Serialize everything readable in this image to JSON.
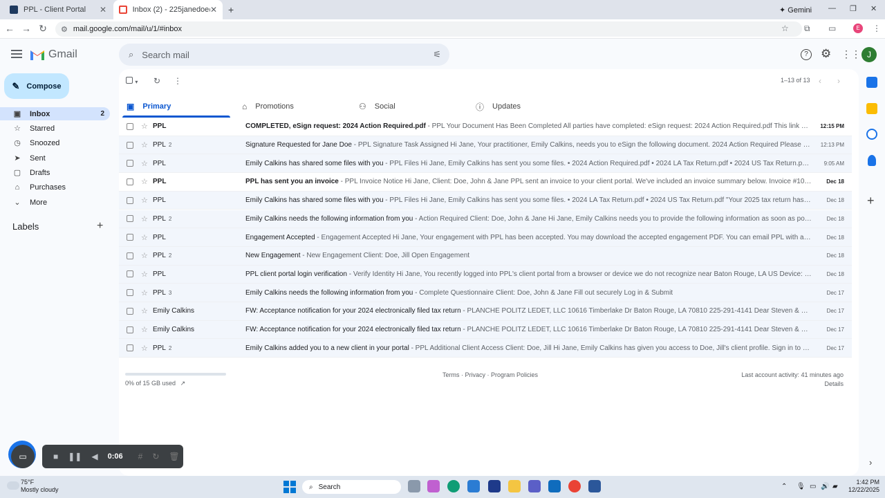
{
  "browser": {
    "tabs": [
      {
        "title": "PPL - Client Portal",
        "active": false
      },
      {
        "title": "Inbox (2) - 225janedoe@gmail...",
        "active": true
      }
    ],
    "new_tab": "+",
    "gemini": "Gemini",
    "url": "mail.google.com/mail/u/1/#inbox",
    "profile_initial": "E"
  },
  "gmail": {
    "logo_text": "Gmail",
    "search_placeholder": "Search mail",
    "avatar_initial": "J",
    "compose_label": "Compose",
    "nav": [
      {
        "label": "Inbox",
        "count": "2",
        "icon": "inbox-icon",
        "selected": true
      },
      {
        "label": "Starred",
        "count": "",
        "icon": "star-icon",
        "selected": false
      },
      {
        "label": "Snoozed",
        "count": "",
        "icon": "clock-icon",
        "selected": false
      },
      {
        "label": "Sent",
        "count": "",
        "icon": "send-icon",
        "selected": false
      },
      {
        "label": "Drafts",
        "count": "",
        "icon": "draft-icon",
        "selected": false
      },
      {
        "label": "Purchases",
        "count": "",
        "icon": "tag-icon",
        "selected": false
      },
      {
        "label": "More",
        "count": "",
        "icon": "chevron-down-icon",
        "selected": false
      }
    ],
    "labels_title": "Labels",
    "pager": "1–13 of 13",
    "category_tabs": [
      {
        "label": "Primary",
        "icon": "inbox-icon",
        "active": true
      },
      {
        "label": "Promotions",
        "icon": "tag-icon",
        "active": false
      },
      {
        "label": "Social",
        "icon": "people-icon",
        "active": false
      },
      {
        "label": "Updates",
        "icon": "info-icon",
        "active": false
      }
    ],
    "emails": [
      {
        "sender": "PPL",
        "count": "",
        "subject": "COMPLETED, eSign request: 2024 Action Required.pdf",
        "snippet": " - PPL Your Document Has Been Completed All parties have completed: eSign request: 2024 Action Required.pdf This link will expir...",
        "date": "12:15 PM",
        "unread": true
      },
      {
        "sender": "PPL",
        "count": "2",
        "subject": "Signature Requested for Jane Doe",
        "snippet": " - PPL Signature Task Assigned Hi Jane, Your practitioner, Emily Calkins, needs you to eSign the following document. 2024 Action Required Please click the...",
        "date": "12:13 PM",
        "unread": false
      },
      {
        "sender": "PPL",
        "count": "",
        "subject": "Emily Calkins has shared some files with you",
        "snippet": " - PPL Files Hi Jane, Emily Calkins has sent you some files. • 2024 Action Required.pdf • 2024 LA Tax Return.pdf • 2024 US Tax Return.pdf \"Your 2...",
        "date": "9:05 AM",
        "unread": false
      },
      {
        "sender": "PPL",
        "count": "",
        "subject": "PPL has sent you an invoice",
        "snippet": " - PPL Invoice Notice Hi Jane, Client: Doe, John & Jane PPL sent an invoice to your client portal. We've included an invoice summary below. Invoice #1067 Invoic...",
        "date": "Dec 18",
        "unread": true
      },
      {
        "sender": "PPL",
        "count": "",
        "subject": "Emily Calkins has shared some files with you",
        "snippet": " - PPL Files Hi Jane, Emily Calkins has sent you some files. • 2024 LA Tax Return.pdf • 2024 US Tax Return.pdf \"Your 2025 tax return has been po...",
        "date": "Dec 18",
        "unread": false
      },
      {
        "sender": "PPL",
        "count": "2",
        "subject": "Emily Calkins needs the following information from you",
        "snippet": " - Action Required Client: Doe, John & Jane Hi Jane, Emily Calkins needs you to provide the following information as soon as possible. ...",
        "date": "Dec 18",
        "unread": false
      },
      {
        "sender": "PPL",
        "count": "",
        "subject": "Engagement Accepted",
        "snippet": " - Engagement Accepted Hi Jane, Your engagement with PPL has been accepted. You may download the accepted engagement PDF. You can email PPL with any ques...",
        "date": "Dec 18",
        "unread": false
      },
      {
        "sender": "PPL",
        "count": "2",
        "subject": "New Engagement",
        "snippet": " - New Engagement Client: Doe, Jill Open Engagement",
        "date": "Dec 18",
        "unread": false
      },
      {
        "sender": "PPL",
        "count": "",
        "subject": "PPL client portal login verification",
        "snippet": " - Verify Identity Hi Jane, You recently logged into PPL's client portal from a browser or device we do not recognize near Baton Rouge, LA US Device: Chrom...",
        "date": "Dec 18",
        "unread": false
      },
      {
        "sender": "PPL",
        "count": "3",
        "subject": "Emily Calkins needs the following information from you",
        "snippet": " - Complete Questionnaire Client: Doe, John & Jane Fill out securely Log in & Submit",
        "date": "Dec 17",
        "unread": false
      },
      {
        "sender": "Emily Calkins",
        "count": "",
        "subject": "FW: Acceptance notification for your 2024 electronically filed tax return",
        "snippet": " - PLANCHE POLITZ LEDET, LLC 10616 Timberlake Dr Baton Rouge, LA 70810 225-291-4141 Dear Steven & Emily: Your ...",
        "date": "Dec 17",
        "unread": false
      },
      {
        "sender": "Emily Calkins",
        "count": "",
        "subject": "FW: Acceptance notification for your 2024 electronically filed tax return",
        "snippet": " - PLANCHE POLITZ LEDET, LLC 10616 Timberlake Dr Baton Rouge, LA 70810 225-291-4141 Dear Steven & Emily: Your ...",
        "date": "Dec 17",
        "unread": false
      },
      {
        "sender": "PPL",
        "count": "2",
        "subject": "Emily Calkins added you to a new client in your portal",
        "snippet": " - PPL Additional Client Access Client: Doe, Jill Hi Jane, Emily Calkins has given you access to Doe, Jill's client profile. Sign in to view Doe...",
        "date": "Dec 17",
        "unread": false
      }
    ],
    "footer": {
      "storage": "0% of 15 GB used",
      "storage_fraction": 0.0,
      "links": "Terms · Privacy · Program Policies",
      "activity": "Last account activity: 41 minutes ago",
      "details": "Details"
    }
  },
  "recorder": {
    "timer": "0:06"
  },
  "taskbar": {
    "weather_temp": "75°F",
    "weather_desc": "Mostly cloudy",
    "search_label": "Search",
    "time": "1:42 PM",
    "date": "12/22/2025"
  }
}
